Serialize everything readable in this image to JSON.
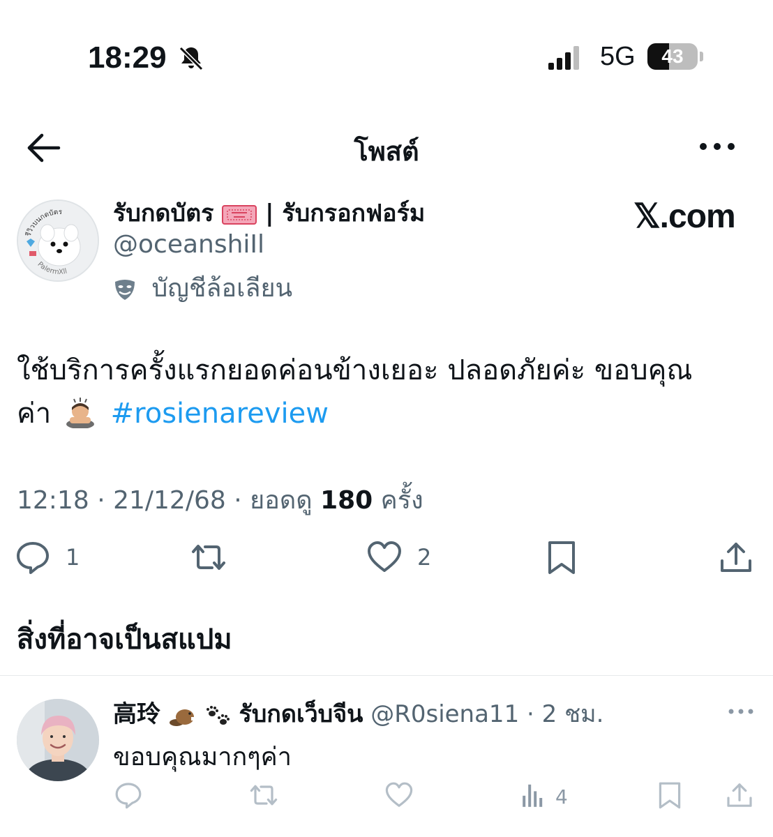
{
  "status_bar": {
    "time": "18:29",
    "network": "5G",
    "battery_level": "43",
    "battery_fraction": 0.43,
    "silent_icon": "bell-slash-icon",
    "signal_icon": "cellular-signal-icon"
  },
  "header": {
    "title": "โพสต์",
    "back_icon": "arrow-left-icon",
    "more_icon": "more-horizontal-icon"
  },
  "post": {
    "author_name_part1": "รับกดบัตร",
    "author_name_part2": "| รับกรอกฟอร์ม",
    "author_name_emoji": "admit-one-ticket-icon",
    "handle": "@oceanshiIl",
    "parody_label": "บัญชีล้อเลียน",
    "avatar_text_top": "รีวิวบนกดบัตร",
    "avatar_text_bottom": "PalermXll",
    "text_line1": "ใช้บริการครั้งแรกยอดค่อนข้างเยอะ ปลอดภัยค่ะ ขอบคุณ",
    "text_line2": "ค่า",
    "text_emoji": "person-bowing-emoji",
    "hashtag": "#rosienareview",
    "time": "12:18",
    "date": "21/12/68",
    "views_label": "ยอดดู",
    "views_count": "180",
    "views_suffix": "ครั้ง",
    "replies": "1",
    "likes": "2",
    "watermark": "𝕏.com"
  },
  "spam_section": {
    "title": "สิ่งที่อาจเป็นสแปม"
  },
  "reply": {
    "name_part1": "高玲",
    "name_part2": "รับกดเว็บจีน",
    "name_emojis": [
      "beaver-emoji",
      "paw-prints-emoji"
    ],
    "handle": "@R0siena11",
    "time": "2 ชม.",
    "text": "ขอบคุณมากๆค่า",
    "views": "4"
  },
  "colors": {
    "accent": "#1d9bf0",
    "text": "#0f1419",
    "secondary": "#536471",
    "muted": "#8b98a5"
  }
}
